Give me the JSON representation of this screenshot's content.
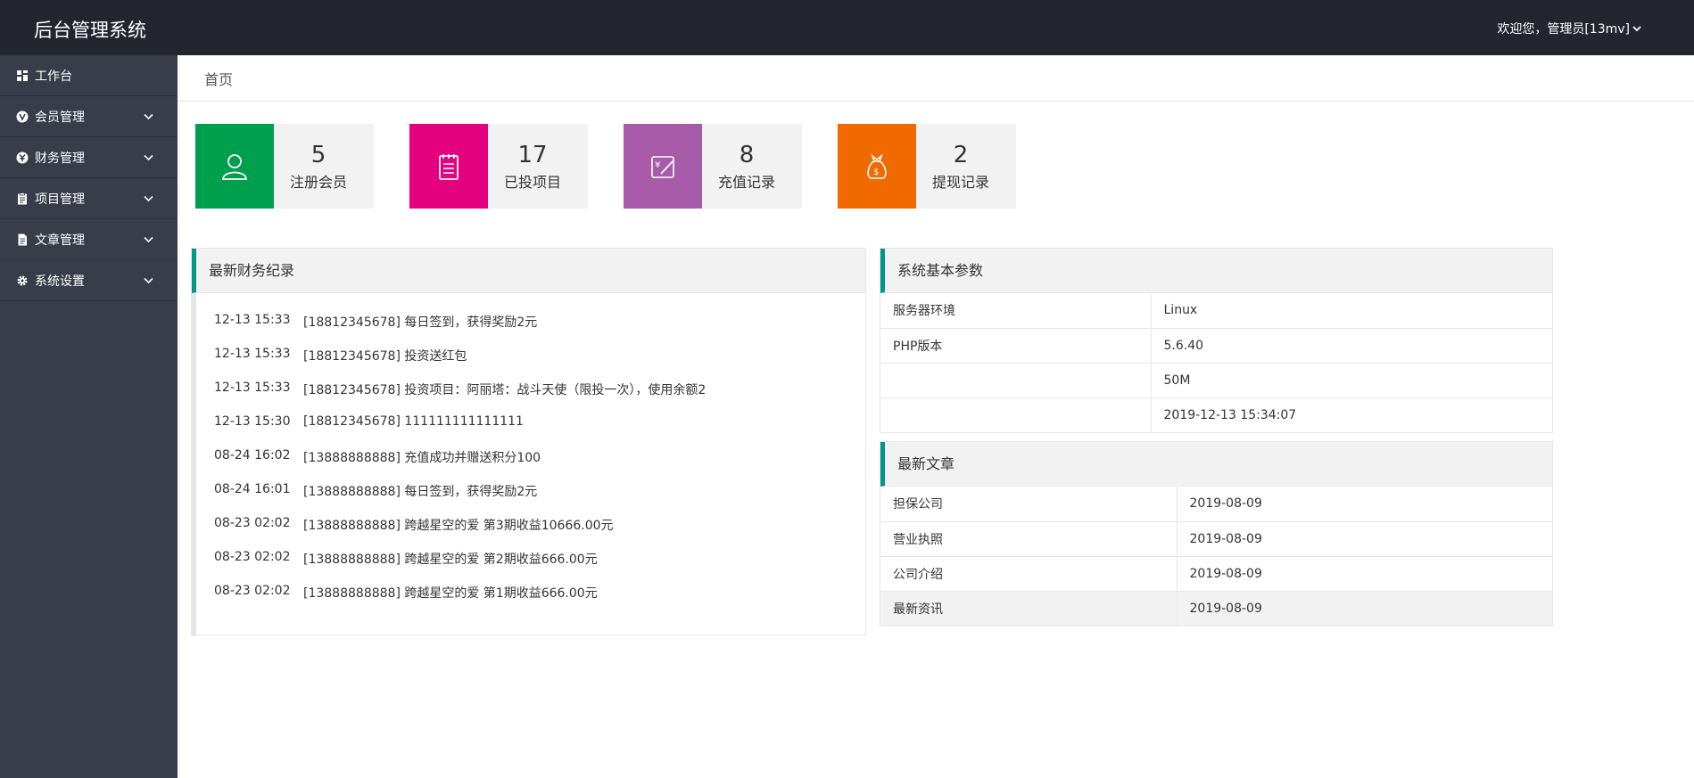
{
  "app": {
    "title": "后台管理系统",
    "user_menu": "欢迎您，管理员[13mv]"
  },
  "sidebar": {
    "items": [
      {
        "label": "工作台",
        "icon": "dashboard-icon"
      },
      {
        "label": "会员管理",
        "icon": "member-icon"
      },
      {
        "label": "财务管理",
        "icon": "finance-icon"
      },
      {
        "label": "项目管理",
        "icon": "project-icon"
      },
      {
        "label": "文章管理",
        "icon": "article-icon"
      },
      {
        "label": "系统设置",
        "icon": "gear-icon"
      }
    ]
  },
  "breadcrumb": "首页",
  "stats": [
    {
      "value": "5",
      "label": "注册会员",
      "color": "#009f4d",
      "icon": "user-icon"
    },
    {
      "value": "17",
      "label": "已投项目",
      "color": "#e5007f",
      "icon": "clipboard-icon"
    },
    {
      "value": "8",
      "label": "充值记录",
      "color": "#a75ba8",
      "icon": "recharge-icon"
    },
    {
      "value": "2",
      "label": "提现记录",
      "color": "#f06a00",
      "icon": "money-bag-icon"
    }
  ],
  "finance_panel": {
    "title": "最新财务纪录",
    "rows": [
      {
        "time": "12-13 15:33",
        "text": "[18812345678] 每日签到，获得奖励2元"
      },
      {
        "time": "12-13 15:33",
        "text": "[18812345678] 投资送红包"
      },
      {
        "time": "12-13 15:33",
        "text": "[18812345678] 投资项目：阿丽塔：战斗天使（限投一次），使用余额2"
      },
      {
        "time": "12-13 15:30",
        "text": "[18812345678] 111111111111111"
      },
      {
        "time": "08-24 16:02",
        "text": "[13888888888] 充值成功并赠送积分100"
      },
      {
        "time": "08-24 16:01",
        "text": "[13888888888] 每日签到，获得奖励2元"
      },
      {
        "time": "08-23 02:02",
        "text": "[13888888888] 跨越星空的爱 第3期收益10666.00元"
      },
      {
        "time": "08-23 02:02",
        "text": "[13888888888] 跨越星空的爱 第2期收益666.00元"
      },
      {
        "time": "08-23 02:02",
        "text": "[13888888888] 跨越星空的爱 第1期收益666.00元"
      }
    ]
  },
  "system_panel": {
    "title": "系统基本参数",
    "rows": [
      {
        "key": "服务器环境",
        "value": "Linux"
      },
      {
        "key": "PHP版本",
        "value": "5.6.40"
      },
      {
        "key": "",
        "value": "50M"
      },
      {
        "key": "",
        "value": "2019-12-13 15:34:07"
      }
    ]
  },
  "article_panel": {
    "title": "最新文章",
    "rows": [
      {
        "title": "担保公司",
        "date": "2019-08-09"
      },
      {
        "title": "营业执照",
        "date": "2019-08-09"
      },
      {
        "title": "公司介绍",
        "date": "2019-08-09"
      },
      {
        "title": "最新资讯",
        "date": "2019-08-09"
      }
    ]
  }
}
